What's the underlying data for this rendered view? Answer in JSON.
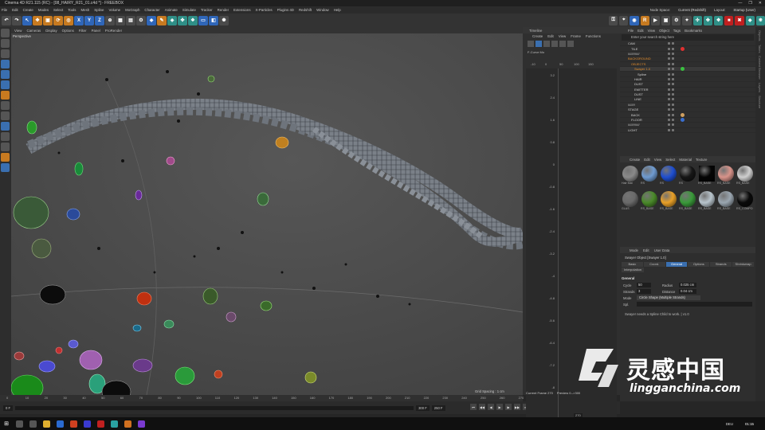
{
  "window": {
    "title": "Cinema 4D R21.115 (RC) - [08_HAIRY_R21_01.c4d *] - FREEBOX",
    "controls": [
      "—",
      "❐",
      "✕"
    ]
  },
  "menubar": {
    "items": [
      "File",
      "Edit",
      "Create",
      "Modes",
      "Select",
      "Tools",
      "Mesh",
      "Spline",
      "Volume",
      "MoGraph",
      "Character",
      "Animate",
      "Simulate",
      "Tracker",
      "Render",
      "Extensions",
      "X-Particles",
      "Plugins 4D",
      "Redshift",
      "Window",
      "Help"
    ],
    "node_space_label": "Node Space:",
    "node_space_value": "Current (Redshift)",
    "layout_label": "Layout:",
    "layout_value": "Startup (User)"
  },
  "toolbar": {
    "axis_x": "X",
    "axis_y": "Y",
    "axis_z": "Z"
  },
  "viewport": {
    "menu": [
      "View",
      "Cameras",
      "Display",
      "Options",
      "Filter",
      "Panel",
      "ProRender"
    ],
    "label": "Perspective",
    "grid_spacing": "Grid Spacing : 1 cm"
  },
  "ruler": {
    "ticks": [
      "0",
      "10",
      "20",
      "30",
      "40",
      "50",
      "60",
      "70",
      "80",
      "90",
      "100",
      "110",
      "120",
      "130",
      "140",
      "150",
      "160",
      "170",
      "180",
      "190",
      "200",
      "210",
      "220",
      "230",
      "240",
      "250",
      "260",
      "270"
    ]
  },
  "timebar": {
    "start": "0 F",
    "current": "0 F",
    "end": "300 F",
    "end2": "250 F"
  },
  "timeline": {
    "title": "Timeline",
    "menu": [
      "Create",
      "Edit",
      "View",
      "Frame",
      "Functions"
    ],
    "track_label": "F-Curve Mo",
    "scale_top": [
      "-10",
      "0",
      "50",
      "100",
      "150"
    ],
    "values": [
      "3.2",
      "2.4",
      "1.6",
      "0.8",
      "0",
      "-0.8",
      "-1.6",
      "-2.4",
      "-3.2",
      "-4",
      "-4.8",
      "-5.6",
      "-6.4",
      "-7.2",
      "-8"
    ],
    "current_frame": "Current Frame  270",
    "preview": "Preview  0-->300",
    "frame_field": "270"
  },
  "object_manager": {
    "menu": [
      "File",
      "Edit",
      "View",
      "Object",
      "Tags",
      "Bookmarks"
    ],
    "search_placeholder": "Enter your search string here",
    "rows": [
      {
        "name": "CAM",
        "orange": false
      },
      {
        "name": "TILE",
        "orange": false
      },
      {
        "name": "/////////////",
        "orange": false
      },
      {
        "name": "BACKGROUND",
        "orange": true
      },
      {
        "name": "OBJECTS",
        "orange": true
      },
      {
        "name": "Swayer 1.0",
        "orange": true
      },
      {
        "name": "Spline",
        "orange": false
      },
      {
        "name": "HAIR",
        "orange": false
      },
      {
        "name": "DUST",
        "orange": false
      },
      {
        "name": "EMITTER",
        "orange": false
      },
      {
        "name": "DUST",
        "orange": false
      },
      {
        "name": "LINE",
        "orange": false
      },
      {
        "name": "////////",
        "orange": false
      },
      {
        "name": "STAGE",
        "orange": false
      },
      {
        "name": "BACK",
        "orange": false
      },
      {
        "name": "FLOOR",
        "orange": false
      },
      {
        "name": "/////////////",
        "orange": false
      },
      {
        "name": "LIGHT",
        "orange": false
      }
    ]
  },
  "material_manager": {
    "menu": [
      "Create",
      "Edit",
      "View",
      "Select",
      "Material",
      "Texture"
    ],
    "materials": [
      {
        "label": "Hair Mat",
        "color": "#8a8a8a"
      },
      {
        "label": "RS",
        "color": "#6f9bd0"
      },
      {
        "label": "RS",
        "color": "#1f4fd0"
      },
      {
        "label": "RS",
        "color": "#161616"
      },
      {
        "label": "RS_BASE",
        "color": "#050505"
      },
      {
        "label": "RS_BASE",
        "color": "#d8938a"
      },
      {
        "label": "RS_BASE",
        "color": "#cfcfcf"
      },
      {
        "label": "GLAS",
        "color": "#6a6a6a"
      },
      {
        "label": "RS_BASE",
        "color": "#4a8a2a"
      },
      {
        "label": "RS_BASE",
        "color": "#e8a028"
      },
      {
        "label": "RS_BASE",
        "color": "#3a9a3a"
      },
      {
        "label": "RS_BASE",
        "color": "#b8c4cc"
      },
      {
        "label": "RS_BASE",
        "color": "#9aa6b0"
      },
      {
        "label": "RS_COMPO",
        "color": "#0a0a0a"
      }
    ]
  },
  "attributes": {
    "menu": [
      "Mode",
      "Edit",
      "User Data"
    ],
    "title": "Swayer Object [Swayer 1.0]",
    "tabs": [
      "Basic",
      "Coord.",
      "General",
      "Options",
      "Strands",
      "Shrinkwrap"
    ],
    "active_tab": "General",
    "subtab": "Interpolation",
    "section": "General",
    "cycle_label": "Cycle",
    "cycle_value": "50",
    "radius_label": "Radius",
    "radius_value": "0.025 cm",
    "strands_label": "Strands",
    "strands_value": "3",
    "distance_label": "Distance",
    "distance_value": "0.04 cm",
    "mode_label": "Mode",
    "mode_value": "Circle Shape (Multiple Strands)",
    "spline_label": "Spl.",
    "note": "Swayer needs a Spline Child to work. | v1.0"
  },
  "right_tabs": [
    "Objects",
    "Takes",
    "Content Browser",
    "Layers",
    "Structure"
  ],
  "taskbar": {
    "lang": "DEU",
    "time": "01:15"
  },
  "watermark": {
    "cn": "灵感中国",
    "url": "lingganchina.com"
  },
  "colors": {
    "accent": "#3a6fb0",
    "orange": "#e08b2b",
    "viewport": "#4b4b4b"
  }
}
